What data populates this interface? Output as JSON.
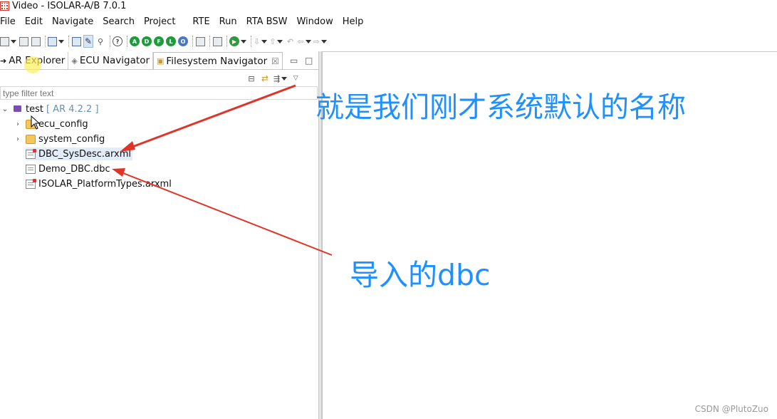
{
  "window": {
    "title": "Video - ISOLAR-A/B 7.0.1"
  },
  "menu": {
    "items": [
      "File",
      "Edit",
      "Navigate",
      "Search",
      "Project",
      "RTE",
      "Run",
      "RTA BSW",
      "Window",
      "Help"
    ]
  },
  "toolbar": {
    "badges": [
      {
        "letter": "A",
        "color": "#1e9b3c"
      },
      {
        "letter": "D",
        "color": "#1e9b3c"
      },
      {
        "letter": "F",
        "color": "#1e9b3c"
      },
      {
        "letter": "L",
        "color": "#1e9b3c"
      },
      {
        "letter": "O",
        "color": "#4a78c2"
      }
    ],
    "help_glyph": "?"
  },
  "left_panel": {
    "tabs": [
      {
        "label": "AR Explorer"
      },
      {
        "label": "ECU Navigator"
      },
      {
        "label": "Filesystem Navigator",
        "close": "☒"
      }
    ],
    "filter_placeholder": "type filter text",
    "tree": {
      "project": {
        "name": "test",
        "tag": "[ AR 4.2.2 ]"
      },
      "folders": [
        "ecu_config",
        "system_config"
      ],
      "files": [
        "DBC_SysDesc.arxml",
        "Demo_DBC.dbc",
        "ISOLAR_PlatformTypes.arxml"
      ]
    }
  },
  "annotations": {
    "top": "就是我们刚才系统默认的名称",
    "bottom": "导入的dbc",
    "color": "#1e90ff",
    "arrow_color": "#e03428"
  },
  "watermark": "CSDN @PlutoZuo"
}
